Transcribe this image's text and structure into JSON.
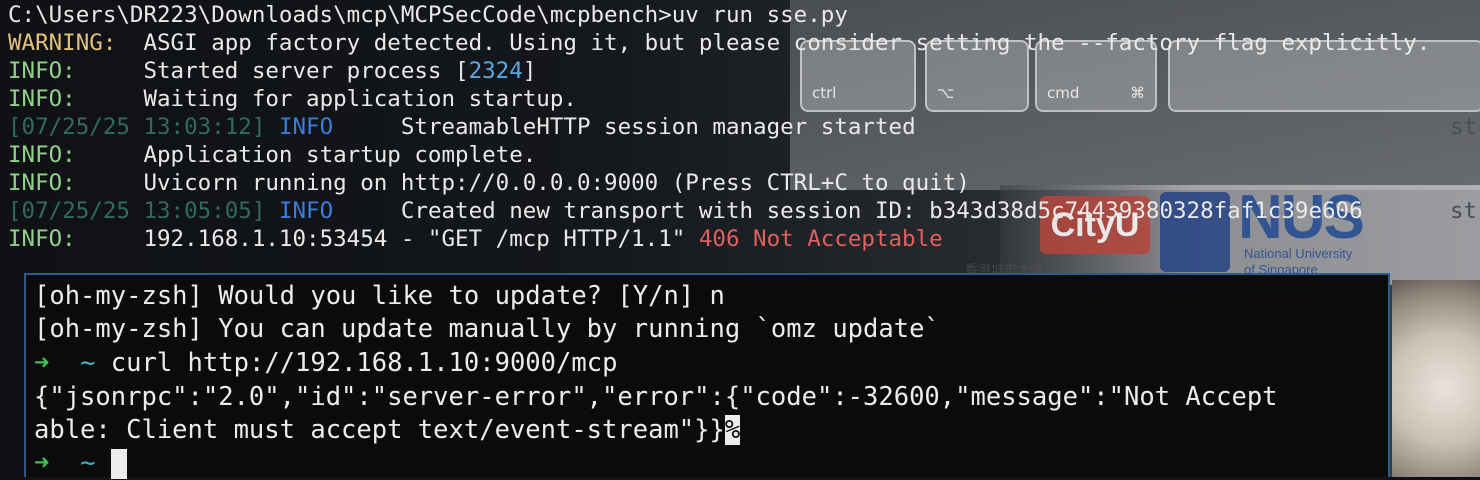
{
  "terminal_top": {
    "lines": [
      {
        "text": "C:\\Users\\DR223\\Downloads\\mcp\\MCPSecCode\\mcpbench>uv run sse.py"
      },
      {
        "level": "WARNING:",
        "msg": "  ASGI app factory detected. Using it, but please consider setting the --factory flag explicitly."
      },
      {
        "level": "INFO:",
        "msg_pre": "     Started server process [",
        "pid": "2324",
        "msg_post": "]"
      },
      {
        "level": "INFO:",
        "msg": "     Waiting for application startup."
      },
      {
        "timestamp": "[07/25/25 13:03:12]",
        "level": "INFO",
        "msg": "     StreamableHTTP session manager started",
        "trail": "str"
      },
      {
        "level": "INFO:",
        "msg": "     Application startup complete."
      },
      {
        "level": "INFO:",
        "msg": "     Uvicorn running on http://0.0.0.0:9000 (Press CTRL+C to quit)"
      },
      {
        "timestamp": "[07/25/25 13:05:05]",
        "level": "INFO",
        "msg": "     Created new transport with session ID: b343d38d5c74439380328faf1c39e606",
        "trail": "str"
      },
      {
        "level": "INFO:",
        "msg": "     192.168.1.10:53454 - \"GET /mcp HTTP/1.1\" ",
        "status": "406 Not Acceptable"
      }
    ]
  },
  "terminal_bottom": {
    "lines": [
      "[oh-my-zsh] Would you like to update? [Y/n] n",
      "[oh-my-zsh] You can update manually by running `omz update`",
      "curl http://192.168.1.10:9000/mcp",
      "{\"jsonrpc\":\"2.0\",\"id\":\"server-error\",\"error\":{\"code\":-32600,\"message\":\"Not Accept",
      "able: Client must accept text/event-stream\"}}"
    ],
    "prompt_arrow": "➜",
    "prompt_dir": "~",
    "percent_marker": "%"
  },
  "keyboard_keys": {
    "ctrl": "ctrl",
    "option": "⌥",
    "cmd": "cmd",
    "cmd_symbol": "⌘"
  },
  "logos": {
    "cityu": "CityU",
    "cityu_sub": "香港城市大學",
    "nus": "NUS",
    "nus_sub1": "National University",
    "nus_sub2": "of Singapore"
  }
}
